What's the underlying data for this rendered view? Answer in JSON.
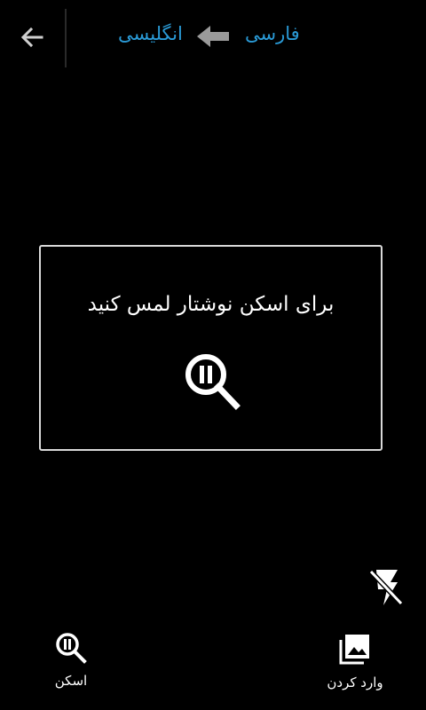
{
  "header": {
    "source_language": "فارسی",
    "target_language": "انگلیسی"
  },
  "scan_area": {
    "message": "برای اسکن نوشتار لمس کنید"
  },
  "bottom_bar": {
    "scan_label": "اسکن",
    "import_label": "وارد کردن"
  },
  "colors": {
    "accent": "#2a9ad6",
    "background": "#000000",
    "frame": "#d9d9d9"
  },
  "icons": [
    "back-arrow-icon",
    "swap-arrow-icon",
    "scan-magnifier-icon",
    "flash-off-icon",
    "gallery-icon"
  ]
}
